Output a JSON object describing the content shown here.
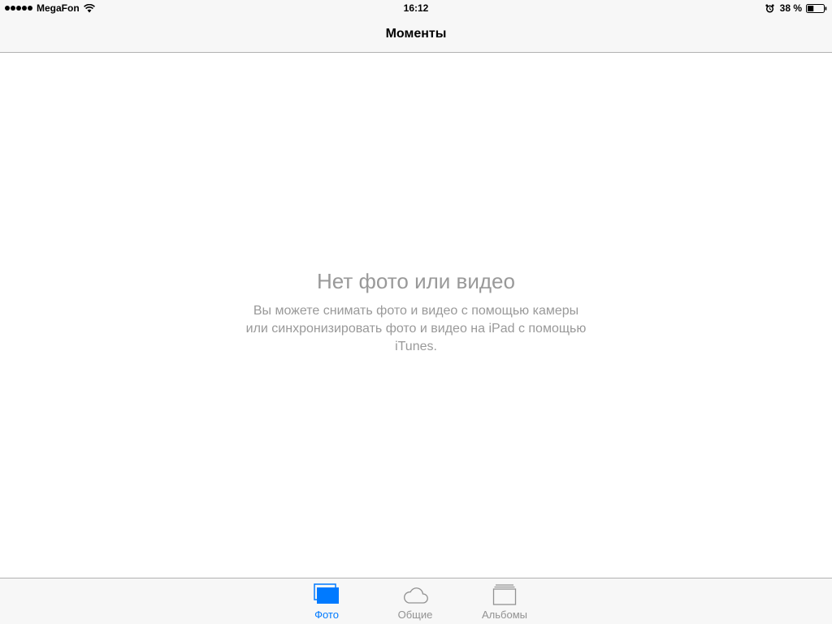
{
  "status_bar": {
    "carrier": "MegaFon",
    "time": "16:12",
    "battery_percent": "38 %",
    "battery_level": 0.38
  },
  "nav_bar": {
    "title": "Моменты"
  },
  "empty_state": {
    "title": "Нет фото или видео",
    "message": "Вы можете снимать фото и видео с помощью камеры или синхронизировать фото и видео на iPad с помощью iTunes."
  },
  "tab_bar": {
    "tabs": [
      {
        "label": "Фото",
        "icon": "photos-icon",
        "active": true
      },
      {
        "label": "Общие",
        "icon": "cloud-icon",
        "active": false
      },
      {
        "label": "Альбомы",
        "icon": "albums-icon",
        "active": false
      }
    ]
  },
  "colors": {
    "accent": "#007aff",
    "inactive": "#929292",
    "empty_text": "#999999",
    "bar_background": "#f7f7f7"
  }
}
